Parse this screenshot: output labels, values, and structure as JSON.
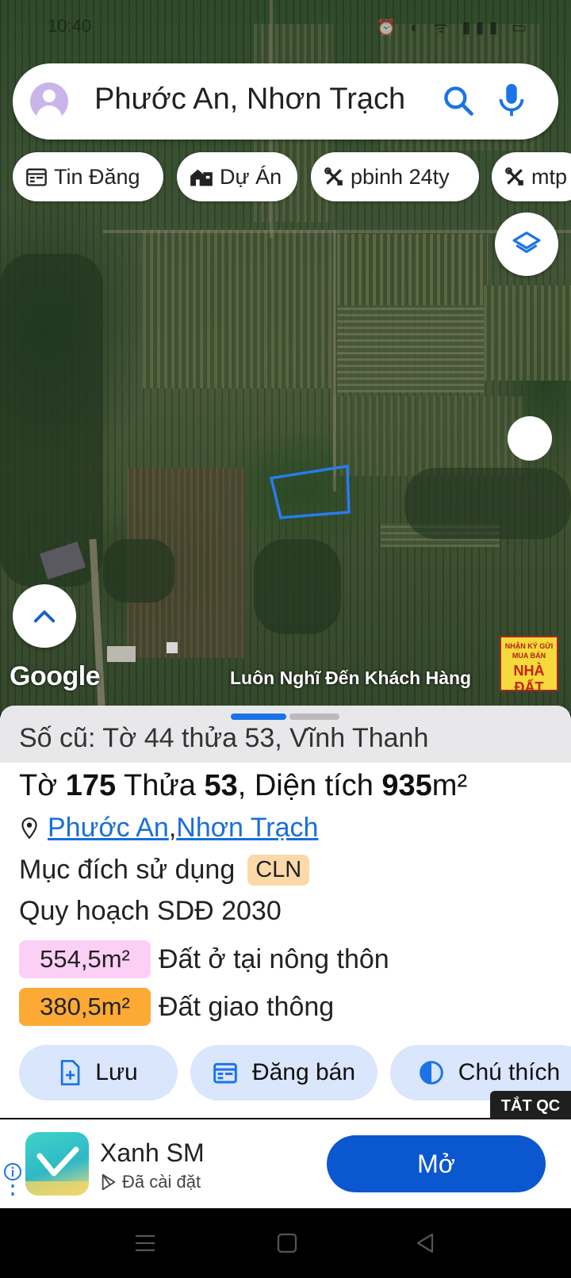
{
  "status_bar": {
    "time": "10:40",
    "icons": "⏰ ◐ ᯤ ▮▮▮ ▭"
  },
  "search": {
    "query": "Phước An, Nhơn Trạch"
  },
  "chips": [
    {
      "label": "Tin Đăng",
      "icon": "calendar-icon"
    },
    {
      "label": "Dự Án",
      "icon": "house-icon"
    },
    {
      "label": "pbinh 24ty",
      "icon": "tools-icon"
    },
    {
      "label": "mtp",
      "icon": "tools-icon"
    }
  ],
  "map": {
    "logo": "Google",
    "slogan": "Luôn Nghĩ Đến Khách Hàng",
    "badge": {
      "line1": "NHẬN KÝ GỬI",
      "line2": "MUA BÁN",
      "line3": "NHÀ ĐẤT"
    }
  },
  "sheet": {
    "old_ref": "Số cũ: Tờ 44 thửa 53, Vĩnh Thanh",
    "title": {
      "pre_sheet": "Tờ ",
      "sheet_no": "175",
      "pre_plot": " Thửa ",
      "plot_no": "53",
      "pre_area": ", Diện tích ",
      "area": "935",
      "unit": "m²"
    },
    "location": {
      "commune": "Phước An",
      "separator": ", ",
      "district": "Nhơn Trạch"
    },
    "usage_label": "Mục đích sử dụng",
    "usage_code": "CLN",
    "plan_title": "Quy hoạch SDĐ 2030",
    "zones": [
      {
        "value": "554,5m²",
        "label": "Đất ở tại nông thôn",
        "color": "#fcd0f6"
      },
      {
        "value": "380,5m²",
        "label": "Đất giao thông",
        "color": "#fcaa33"
      }
    ],
    "actions": {
      "save": "Lưu",
      "post": "Đăng bán",
      "legend": "Chú thích"
    }
  },
  "ad": {
    "close_label": "TẮT QC",
    "app_name": "Xanh SM",
    "app_status": "Đã cài đặt",
    "open_label": "Mở"
  },
  "colors": {
    "accent": "#1a73e8",
    "button_blue": "#0b57d0",
    "parcel_outline": "#2a7bf0"
  }
}
